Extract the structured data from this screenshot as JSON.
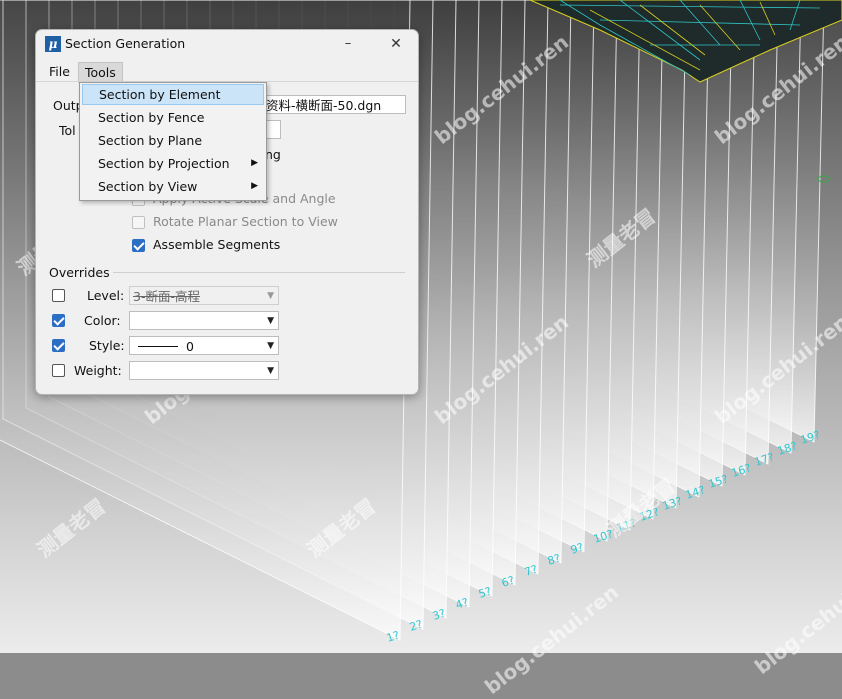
{
  "dialog": {
    "title": "Section Generation",
    "window_buttons": {
      "minimize": "–",
      "maximize": "☐",
      "close": "✕"
    }
  },
  "menubar": {
    "file": "File",
    "tools": "Tools"
  },
  "tools_menu": {
    "items": [
      {
        "label": "Section by Element",
        "highlighted": true,
        "submenu": false
      },
      {
        "label": "Section by Fence",
        "highlighted": false,
        "submenu": false
      },
      {
        "label": "Section by Plane",
        "highlighted": false,
        "submenu": false
      },
      {
        "label": "Section by Projection",
        "highlighted": false,
        "submenu": true
      },
      {
        "label": "Section by View",
        "highlighted": false,
        "submenu": true
      }
    ],
    "submenu_arrow": "▶"
  },
  "form": {
    "output_label": "Outp",
    "output_value": "资料-横断面-50.dgn",
    "tolerance_label": "Tol",
    "partial_option_tail": "ng",
    "apply_active_scale": "Apply Active Scale and Angle",
    "rotate_planar": "Rotate Planar Section to View",
    "assemble_segments": "Assemble Segments",
    "assemble_checked": true
  },
  "overrides": {
    "heading": "Overrides",
    "level_label": "Level:",
    "level_value": "3-断面-高程",
    "level_checked": false,
    "color_label": "Color:",
    "color_value": "",
    "color_checked": true,
    "style_label": "Style:",
    "style_value": "0",
    "style_checked": true,
    "weight_label": "Weight:",
    "weight_value": "",
    "weight_checked": false,
    "dropdown_arrow": "▼"
  },
  "watermarks": [
    "测量老冒",
    "blog.cehui.ren"
  ],
  "station_labels": [
    "1?",
    "2?",
    "3?",
    "4?",
    "5?",
    "6?",
    "7?",
    "8?",
    "9?",
    "10?",
    "11?",
    "12?",
    "13?",
    "14?",
    "15?",
    "16?",
    "17?",
    "18?",
    "19?"
  ],
  "colors": {
    "accent": "#2c6ec4",
    "menu_highlight": "#cce4f7",
    "background": "#8c8c8c"
  }
}
